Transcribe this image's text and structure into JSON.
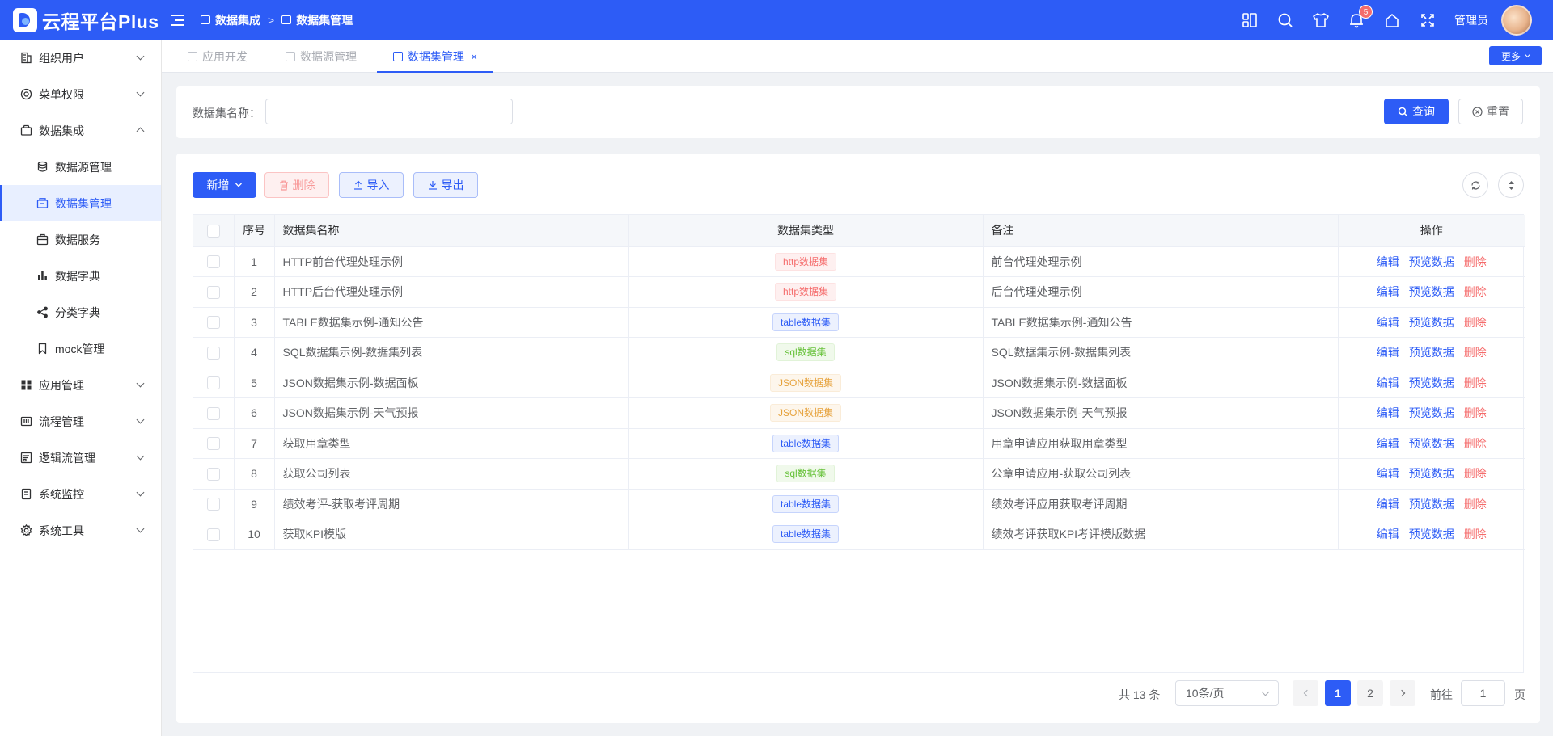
{
  "app": {
    "title": "云程平台Plus"
  },
  "breadcrumb": [
    "数据集成",
    "数据集管理"
  ],
  "header": {
    "notification_count": "5",
    "user_name": "管理员"
  },
  "sidebar": {
    "items": [
      {
        "label": "组织用户",
        "icon": "building-icon",
        "expandable": true
      },
      {
        "label": "菜单权限",
        "icon": "shield-icon",
        "expandable": true
      },
      {
        "label": "数据集成",
        "icon": "box-icon",
        "expandable": true,
        "expanded": true
      },
      {
        "label": "数据源管理",
        "icon": "database-icon",
        "sub": true
      },
      {
        "label": "数据集管理",
        "icon": "dataset-icon",
        "sub": true,
        "active": true
      },
      {
        "label": "数据服务",
        "icon": "service-icon",
        "sub": true
      },
      {
        "label": "数据字典",
        "icon": "bar-chart-icon",
        "sub": true
      },
      {
        "label": "分类字典",
        "icon": "share-icon",
        "sub": true
      },
      {
        "label": "mock管理",
        "icon": "bookmark-icon",
        "sub": true
      },
      {
        "label": "应用管理",
        "icon": "grid-icon",
        "expandable": true
      },
      {
        "label": "流程管理",
        "icon": "flow-icon",
        "expandable": true
      },
      {
        "label": "逻辑流管理",
        "icon": "logic-icon",
        "expandable": true
      },
      {
        "label": "系统监控",
        "icon": "monitor-icon",
        "expandable": true
      },
      {
        "label": "系统工具",
        "icon": "gear-icon",
        "expandable": true
      }
    ]
  },
  "tabs": [
    {
      "label": "应用开发",
      "active": false
    },
    {
      "label": "数据源管理",
      "active": false
    },
    {
      "label": "数据集管理",
      "active": true
    }
  ],
  "more_label": "更多",
  "search": {
    "label": "数据集名称：",
    "placeholder": "",
    "query_label": "查询",
    "reset_label": "重置"
  },
  "toolbar": {
    "add_label": "新增",
    "delete_label": "删除",
    "import_label": "导入",
    "export_label": "导出"
  },
  "table": {
    "columns": [
      "序号",
      "数据集名称",
      "数据集类型",
      "备注",
      "操作"
    ],
    "actions": [
      "编辑",
      "预览数据",
      "删除"
    ],
    "rows": [
      {
        "no": "1",
        "name": "HTTP前台代理处理示例",
        "type": "http数据集",
        "type_kind": "http",
        "remark": "前台代理处理示例"
      },
      {
        "no": "2",
        "name": "HTTP后台代理处理示例",
        "type": "http数据集",
        "type_kind": "http",
        "remark": "后台代理处理示例"
      },
      {
        "no": "3",
        "name": "TABLE数据集示例-通知公告",
        "type": "table数据集",
        "type_kind": "table",
        "remark": "TABLE数据集示例-通知公告"
      },
      {
        "no": "4",
        "name": "SQL数据集示例-数据集列表",
        "type": "sql数据集",
        "type_kind": "sql",
        "remark": "SQL数据集示例-数据集列表"
      },
      {
        "no": "5",
        "name": "JSON数据集示例-数据面板",
        "type": "JSON数据集",
        "type_kind": "json",
        "remark": "JSON数据集示例-数据面板"
      },
      {
        "no": "6",
        "name": "JSON数据集示例-天气预报",
        "type": "JSON数据集",
        "type_kind": "json",
        "remark": "JSON数据集示例-天气预报"
      },
      {
        "no": "7",
        "name": "获取用章类型",
        "type": "table数据集",
        "type_kind": "table",
        "remark": "用章申请应用获取用章类型"
      },
      {
        "no": "8",
        "name": "获取公司列表",
        "type": "sql数据集",
        "type_kind": "sql",
        "remark": "公章申请应用-获取公司列表"
      },
      {
        "no": "9",
        "name": "绩效考评-获取考评周期",
        "type": "table数据集",
        "type_kind": "table",
        "remark": "绩效考评应用获取考评周期"
      },
      {
        "no": "10",
        "name": "获取KPI模版",
        "type": "table数据集",
        "type_kind": "table",
        "remark": "绩效考评获取KPI考评模版数据"
      }
    ]
  },
  "tag_colors": {
    "http": {
      "bg": "#fef0f0",
      "border": "#fde2e2",
      "color": "#f56c6c"
    },
    "table": {
      "bg": "#ecf1fe",
      "border": "#c6d4fc",
      "color": "#2d5cf6"
    },
    "sql": {
      "bg": "#f0f9eb",
      "border": "#e1f3d8",
      "color": "#67c23a"
    },
    "json": {
      "bg": "#fdf6ec",
      "border": "#faecd8",
      "color": "#e6a23c"
    }
  },
  "pagination": {
    "total_text": "共 13 条",
    "page_size": "10条/页",
    "pages": [
      "1",
      "2"
    ],
    "current": "1",
    "goto_label": "前往",
    "goto_value": "1",
    "goto_suffix": "页"
  },
  "colors": {
    "primary": "#2d5cf6",
    "danger": "#f56c6c"
  }
}
